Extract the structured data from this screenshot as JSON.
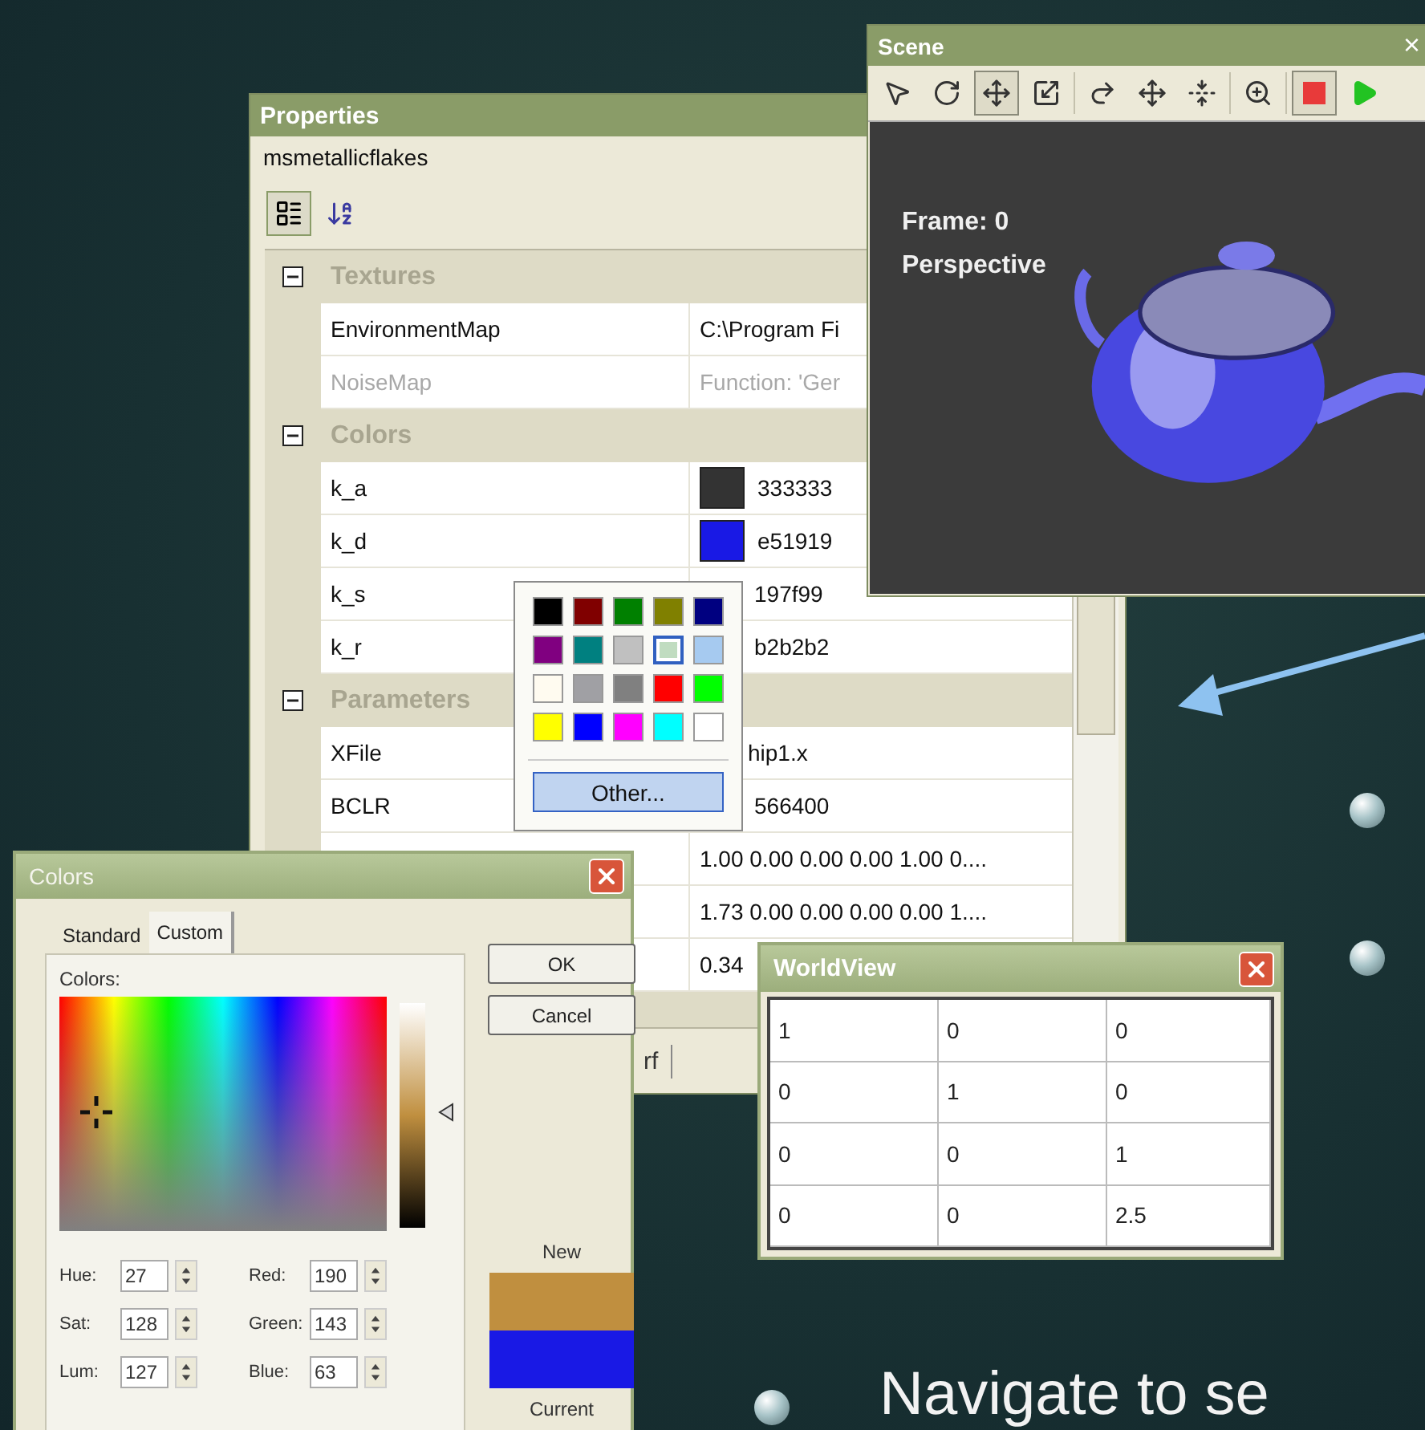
{
  "properties": {
    "title": "Properties",
    "object": "msmetallicflakes",
    "tools": [
      {
        "kind": "categorized",
        "selected": true
      },
      {
        "kind": "alphabetical",
        "selected": false
      }
    ],
    "groups": [
      {
        "name": "Textures",
        "expanded": true,
        "rows": [
          {
            "name": "EnvironmentMap",
            "kind": "text",
            "value": "C:\\Program Fi",
            "disabled": false
          },
          {
            "name": "NoiseMap",
            "kind": "text",
            "value": "Function: 'Ger",
            "disabled": true
          }
        ]
      },
      {
        "name": "Colors",
        "expanded": true,
        "rows": [
          {
            "name": "k_a",
            "kind": "color",
            "color": "#333333",
            "value": "333333",
            "disabled": false
          },
          {
            "name": "k_d",
            "kind": "color",
            "color": "#1919e5",
            "value": "e51919",
            "disabled": false
          },
          {
            "name": "k_s",
            "kind": "color",
            "value": "197f99",
            "disabled": false
          },
          {
            "name": "k_r",
            "kind": "color",
            "value": "b2b2b2",
            "disabled": false
          }
        ]
      },
      {
        "name": "Parameters",
        "expanded": true,
        "rows": [
          {
            "name": "XFile",
            "kind": "file",
            "value": "hip1.x",
            "disabled": false
          },
          {
            "name": "BCLR",
            "kind": "color",
            "value": "566400",
            "disabled": false
          },
          {
            "kind": "text",
            "value": "1.00 0.00 0.00 0.00 1.00 0....",
            "disabled": false
          },
          {
            "kind": "text",
            "value": "1.73 0.00 0.00 0.00 0.00 1....",
            "disabled": false
          },
          {
            "kind": "text",
            "value": "0.34",
            "disabled": false
          }
        ]
      }
    ],
    "tab": "rf"
  },
  "scene": {
    "title": "Scene",
    "close": "×",
    "tools": [
      {
        "kind": "pointer",
        "selected": false
      },
      {
        "kind": "orbit",
        "selected": false
      },
      {
        "kind": "move",
        "selected": true
      },
      {
        "kind": "scale",
        "selected": false
      },
      {
        "kind": "arc",
        "selected": false
      },
      {
        "kind": "pan",
        "selected": false
      },
      {
        "kind": "flatten",
        "selected": false
      },
      {
        "kind": "zoom",
        "selected": false
      },
      {
        "kind": "stop",
        "selected": true
      },
      {
        "kind": "play",
        "selected": false
      }
    ],
    "frame": "Frame: 0",
    "view": "Perspective"
  },
  "palette": {
    "swatches": [
      {
        "color": "#000000",
        "selected": false
      },
      {
        "color": "#800000",
        "selected": false
      },
      {
        "color": "#008000",
        "selected": false
      },
      {
        "color": "#808000",
        "selected": false
      },
      {
        "color": "#000080",
        "selected": false
      },
      {
        "color": "#800080",
        "selected": false
      },
      {
        "color": "#008080",
        "selected": false
      },
      {
        "color": "#c0c0c0",
        "selected": false
      },
      {
        "color": "#c0dcc0",
        "selected": true
      },
      {
        "color": "#a6caf0",
        "selected": false
      },
      {
        "color": "#fffbf0",
        "selected": false
      },
      {
        "color": "#a0a0a4",
        "selected": false
      },
      {
        "color": "#808080",
        "selected": false
      },
      {
        "color": "#ff0000",
        "selected": false
      },
      {
        "color": "#00ff00",
        "selected": false
      },
      {
        "color": "#ffff00",
        "selected": false
      },
      {
        "color": "#0000ff",
        "selected": false
      },
      {
        "color": "#ff00ff",
        "selected": false
      },
      {
        "color": "#00ffff",
        "selected": false
      },
      {
        "color": "#ffffff",
        "selected": false
      }
    ],
    "other": "Other..."
  },
  "colors_dialog": {
    "title": "Colors",
    "tabs": [
      {
        "label": "Standard",
        "selected": false
      },
      {
        "label": "Custom",
        "selected": true
      }
    ],
    "colors_label": "Colors:",
    "buttons": [
      "OK",
      "Cancel"
    ],
    "fields": [
      {
        "label": "Hue:",
        "value": "27"
      },
      {
        "label": "Red:",
        "value": "190"
      },
      {
        "label": "Sat:",
        "value": "128"
      },
      {
        "label": "Green:",
        "value": "143"
      },
      {
        "label": "Lum:",
        "value": "127"
      },
      {
        "label": "Blue:",
        "value": "63"
      }
    ],
    "preview": [
      {
        "label": "New",
        "color": "#c08f3f"
      },
      {
        "label": "Current",
        "color": "#1919e5"
      }
    ]
  },
  "worldview": {
    "title": "WorldView",
    "rows": [
      [
        "1",
        "0",
        "0"
      ],
      [
        "0",
        "1",
        "0"
      ],
      [
        "0",
        "0",
        "1"
      ],
      [
        "0",
        "0",
        "2.5"
      ]
    ]
  },
  "slide": {
    "text": "Navigate to se"
  }
}
